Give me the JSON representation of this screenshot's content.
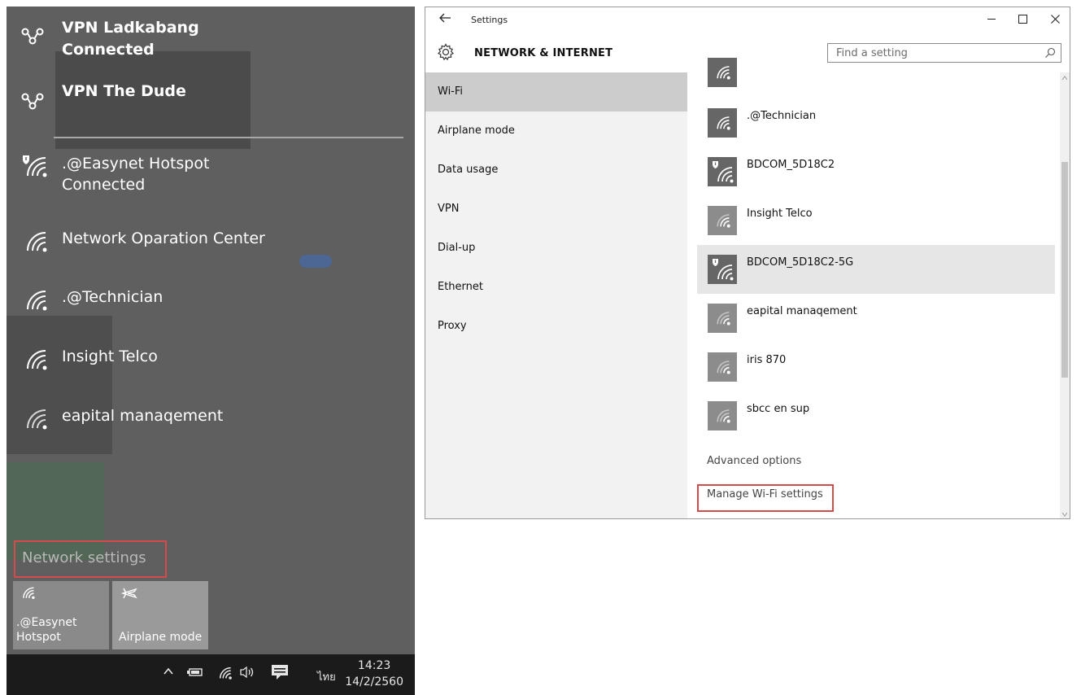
{
  "flyout": {
    "vpns": [
      {
        "name": "VPN Ladkabang",
        "status": "Connected"
      },
      {
        "name": "VPN The Dude",
        "status": ""
      }
    ],
    "networks": [
      {
        "name": ".@Easynet Hotspot",
        "status": "Connected",
        "secured": true
      },
      {
        "name": "Network Oparation Center",
        "status": "",
        "secured": false
      },
      {
        "name": ".@Technician",
        "status": "",
        "secured": false
      },
      {
        "name": "Insight Telco",
        "status": "",
        "secured": false
      },
      {
        "name": "eapital manaqement",
        "status": "",
        "secured": false
      }
    ],
    "network_settings_label": "Network settings",
    "tiles": [
      {
        "label_line1": ".@Easynet",
        "label_line2": "Hotspot",
        "icon": "wifi-icon"
      },
      {
        "label_line1": "",
        "label_line2": "Airplane mode",
        "icon": "airplane-icon"
      }
    ],
    "taskbar": {
      "input_language": "ไทย",
      "time": "14:23",
      "date": "14/2/2560"
    }
  },
  "settings": {
    "window_title": "Settings",
    "section_title": "NETWORK & INTERNET",
    "search_placeholder": "Find a setting",
    "nav_items": [
      {
        "label": "Wi-Fi",
        "active": true
      },
      {
        "label": "Airplane mode",
        "active": false
      },
      {
        "label": "Data usage",
        "active": false
      },
      {
        "label": "VPN",
        "active": false
      },
      {
        "label": "Dial-up",
        "active": false
      },
      {
        "label": "Ethernet",
        "active": false
      },
      {
        "label": "Proxy",
        "active": false
      }
    ],
    "networks": [
      {
        "name": ".@Technician",
        "secured": false,
        "selected": false
      },
      {
        "name": "BDCOM_5D18C2",
        "secured": true,
        "selected": false
      },
      {
        "name": "Insight Telco",
        "secured": false,
        "selected": false
      },
      {
        "name": "BDCOM_5D18C2-5G",
        "secured": true,
        "selected": true
      },
      {
        "name": "eapital manaqement",
        "secured": false,
        "selected": false
      },
      {
        "name": "iris 870",
        "secured": false,
        "selected": false
      },
      {
        "name": "sbcc en sup",
        "secured": false,
        "selected": false
      }
    ],
    "advanced_options_label": "Advanced options",
    "manage_wifi_label": "Manage Wi-Fi settings",
    "colors": {
      "highlight_box": "#d44b4b",
      "nav_active": "#cccccc",
      "selected_row": "#e6e6e6"
    }
  }
}
